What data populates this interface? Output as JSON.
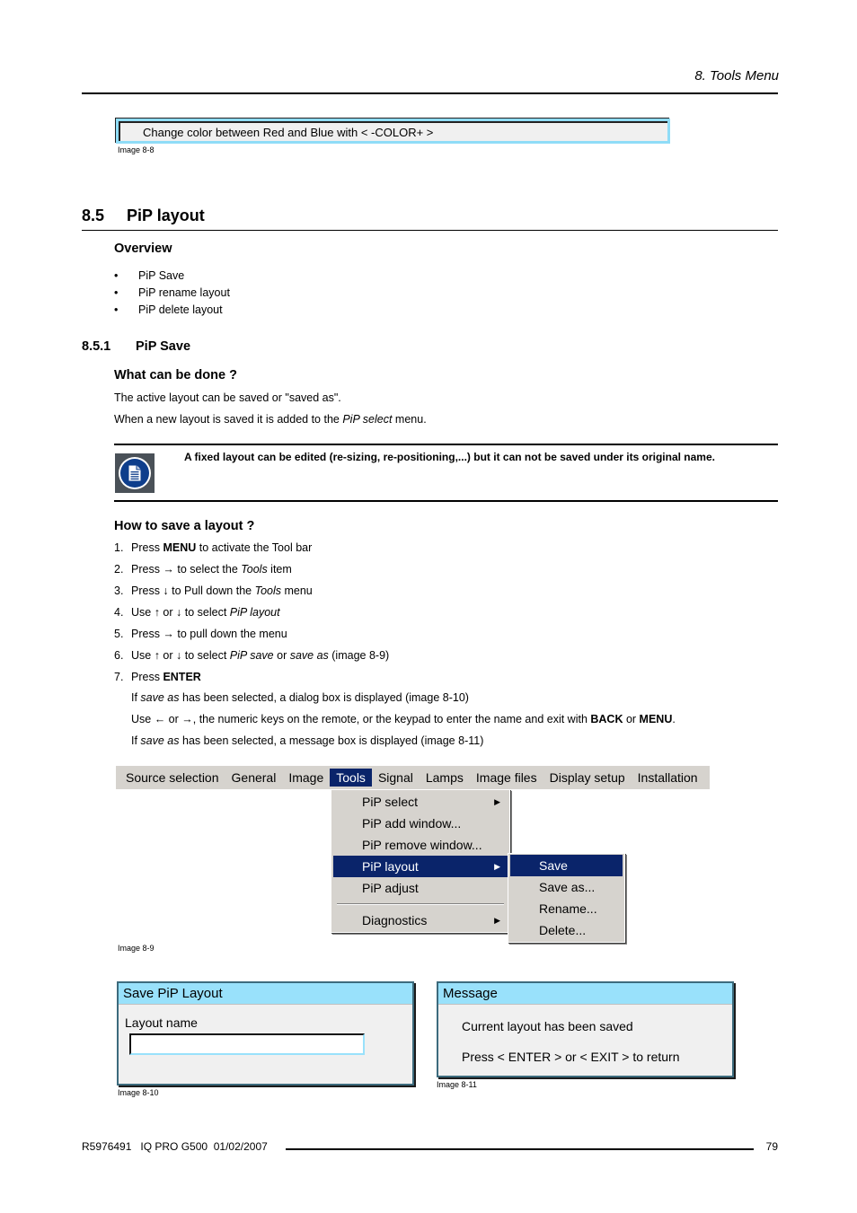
{
  "header": {
    "chapter": "8.  Tools Menu"
  },
  "image_8_8": {
    "text": "Change color between Red and Blue with < -COLOR+ >",
    "caption": "Image 8-8"
  },
  "section": {
    "number": "8.5",
    "title": "PiP layout",
    "overview_heading": "Overview",
    "overview_items": [
      "PiP Save",
      "PiP rename layout",
      "PiP delete layout"
    ],
    "bullet_glyph": "•"
  },
  "subsection": {
    "number": "8.5.1",
    "title": "PiP Save",
    "what_heading": "What can be done ?",
    "para1": "The active layout can be saved or \"saved as\".",
    "para2_pre": "When a new layout is saved it is added to the ",
    "para2_em": "PiP select",
    "para2_post": " menu.",
    "note": "A fixed layout can be edited (re-sizing, re-positioning,...) but it can not be saved under its original name.",
    "note_icon": "note-document-icon",
    "how_heading": "How to save a layout ?"
  },
  "steps": [
    {
      "n": "1.",
      "parts": [
        [
          "t",
          "Press "
        ],
        [
          "b",
          "MENU"
        ],
        [
          "t",
          " to activate the Tool bar"
        ]
      ]
    },
    {
      "n": "2.",
      "parts": [
        [
          "t",
          "Press → to select the "
        ],
        [
          "i",
          "Tools"
        ],
        [
          "t",
          " item"
        ]
      ]
    },
    {
      "n": "3.",
      "parts": [
        [
          "t",
          "Press ↓ to Pull down the "
        ],
        [
          "i",
          "Tools"
        ],
        [
          "t",
          " menu"
        ]
      ]
    },
    {
      "n": "4.",
      "parts": [
        [
          "t",
          "Use ↑ or ↓ to select "
        ],
        [
          "i",
          "PiP layout"
        ]
      ]
    },
    {
      "n": "5.",
      "parts": [
        [
          "t",
          "Press → to pull down the menu"
        ]
      ]
    },
    {
      "n": "6.",
      "parts": [
        [
          "t",
          "Use ↑ or ↓ to select "
        ],
        [
          "i",
          "PiP save"
        ],
        [
          "t",
          " or "
        ],
        [
          "i",
          "save as"
        ],
        [
          "t",
          " (image 8-9)"
        ]
      ]
    },
    {
      "n": "7.",
      "parts": [
        [
          "t",
          "Press "
        ],
        [
          "b",
          "ENTER"
        ]
      ]
    }
  ],
  "substeps": [
    {
      "parts": [
        [
          "t",
          "If "
        ],
        [
          "i",
          "save as"
        ],
        [
          "t",
          " has been selected, a dialog box is displayed (image 8-10)"
        ]
      ]
    },
    {
      "parts": [
        [
          "t",
          "Use ← or →, the numeric keys on the remote, or the keypad to enter the name and exit with "
        ],
        [
          "b",
          "BACK"
        ],
        [
          "t",
          " or "
        ],
        [
          "b",
          "MENU"
        ],
        [
          "t",
          "."
        ]
      ]
    },
    {
      "parts": [
        [
          "t",
          "If "
        ],
        [
          "i",
          "save as"
        ],
        [
          "t",
          " has been selected, a message box is displayed (image 8-11)"
        ]
      ]
    }
  ],
  "image_8_9": {
    "menubar": [
      "Source selection",
      "General",
      "Image",
      "Tools",
      "Signal",
      "Lamps",
      "Image files",
      "Display setup",
      "Installation"
    ],
    "active_menu": "Tools",
    "tools_menu": [
      {
        "label": "PiP select",
        "submenu": true
      },
      {
        "label": "PiP add window...",
        "submenu": false
      },
      {
        "label": "PiP remove window...",
        "submenu": false
      },
      {
        "label": "PiP layout",
        "submenu": true,
        "selected": true
      },
      {
        "label": "PiP adjust",
        "submenu": false
      },
      {
        "separator": true
      },
      {
        "label": "Diagnostics",
        "submenu": true
      }
    ],
    "layout_submenu": [
      {
        "label": "Save",
        "selected": true
      },
      {
        "label": "Save as..."
      },
      {
        "label": "Rename..."
      },
      {
        "label": "Delete..."
      }
    ],
    "submenu_arrow": "▶",
    "caption": "Image 8-9"
  },
  "image_8_10": {
    "title": "Save PiP Layout",
    "field_label": "Layout name",
    "field_value": "",
    "caption": "Image 8-10"
  },
  "image_8_11": {
    "title": "Message",
    "line1": "Current layout has been saved",
    "line2": "Press < ENTER > or < EXIT > to return",
    "caption": "Image 8-11"
  },
  "footer": {
    "doc": "R5976491   IQ PRO G500  01/02/2007",
    "page": "79"
  }
}
